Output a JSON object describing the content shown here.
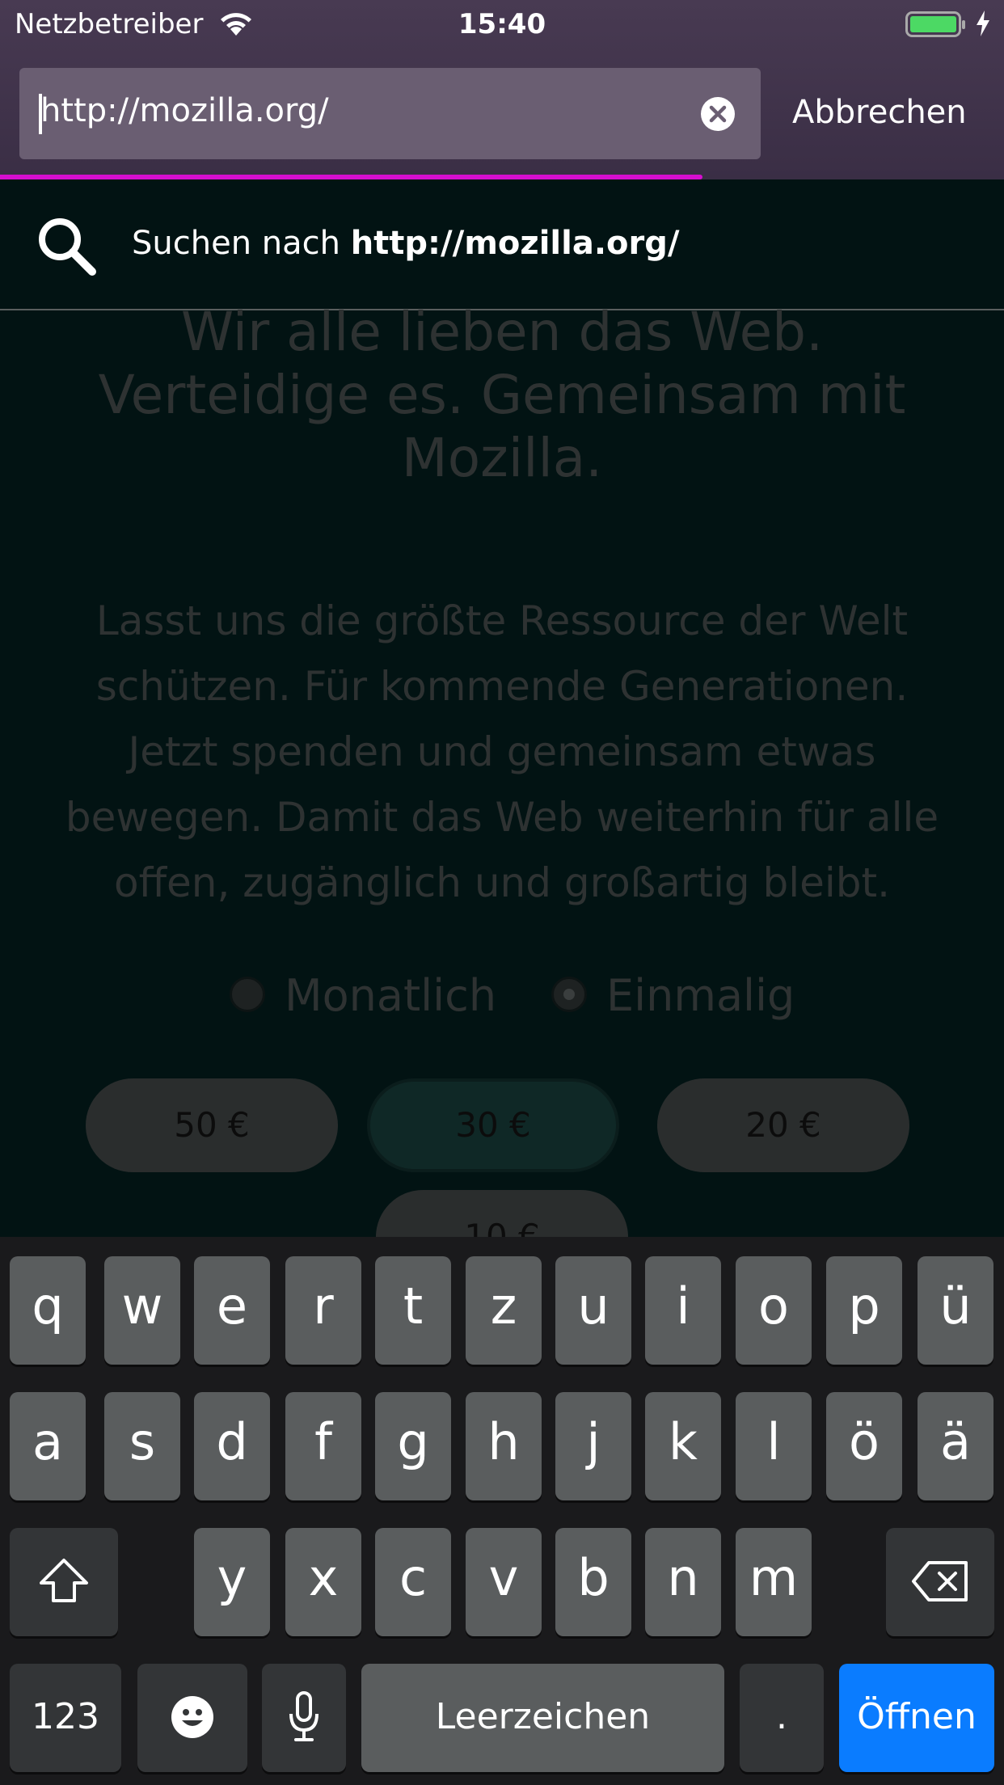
{
  "status_bar": {
    "carrier": "Netzbetreiber",
    "time": "15:40"
  },
  "url_bar": {
    "value": "http://mozilla.org/",
    "cancel_label": "Abbrechen",
    "load_progress": 0.7
  },
  "suggestion": {
    "prefix": "Suchen nach ",
    "query": "http://mozilla.org/"
  },
  "page": {
    "heading": "Wir alle lieben das Web. Verteidige es. Gemeinsam mit Mozilla.",
    "body": "Lasst uns die größte Ressource der Welt schützen. Für kommende Generationen. Jetzt spenden und gemeinsam etwas bewegen. Damit das Web weiterhin für alle offen, zugänglich und großartig bleibt.",
    "frequency": [
      {
        "label": "Monatlich",
        "selected": false
      },
      {
        "label": "Einmalig",
        "selected": true
      }
    ],
    "amounts": [
      "50 €",
      "30 €",
      "20 €",
      "10 €"
    ],
    "selected_amount": "30 €"
  },
  "keyboard": {
    "row1": [
      "q",
      "w",
      "e",
      "r",
      "t",
      "z",
      "u",
      "i",
      "o",
      "p",
      "ü"
    ],
    "row2": [
      "a",
      "s",
      "d",
      "f",
      "g",
      "h",
      "j",
      "k",
      "l",
      "ö",
      "ä"
    ],
    "row3": [
      "y",
      "x",
      "c",
      "v",
      "b",
      "n",
      "m"
    ],
    "numbers_label": "123",
    "space_label": "Leerzeichen",
    "period_label": ".",
    "return_label": "Öffnen"
  },
  "colors": {
    "progress": "#d60fd0",
    "return_key": "#0a7cff",
    "battery": "#4cd964"
  }
}
